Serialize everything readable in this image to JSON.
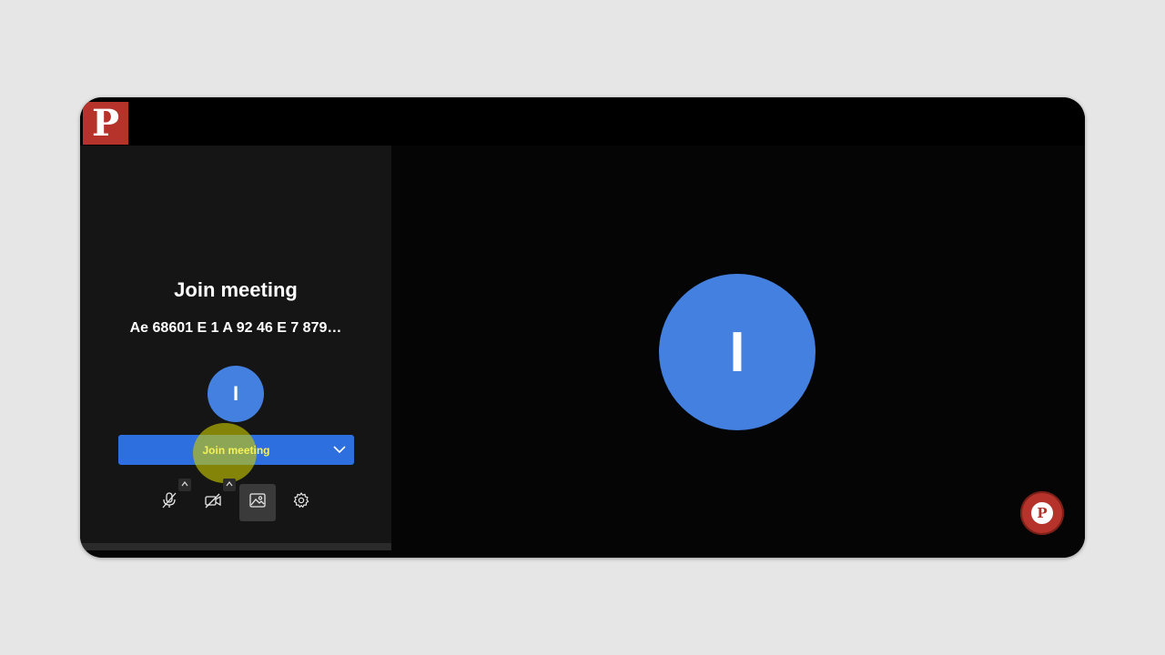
{
  "app": {
    "logo_letter": "P",
    "brand_color": "#b5332a"
  },
  "join_panel": {
    "title": "Join meeting",
    "meeting_id": "Ae 68601 E 1 A 92 46 E 7 879…",
    "avatar_initial": "I",
    "avatar_color": "#4380e0",
    "join_button_label": "Join meeting",
    "join_button_color": "#2e6fe0"
  },
  "controls": [
    {
      "name": "microphone-muted",
      "icon": "mic-off-icon",
      "has_dropdown": true
    },
    {
      "name": "camera-off",
      "icon": "camera-off-icon",
      "has_dropdown": true
    },
    {
      "name": "background-effects",
      "icon": "image-icon",
      "active": true
    },
    {
      "name": "settings",
      "icon": "gear-icon"
    }
  ],
  "preview": {
    "avatar_initial": "I",
    "avatar_color": "#4380e0"
  },
  "fab": {
    "letter": "P"
  }
}
